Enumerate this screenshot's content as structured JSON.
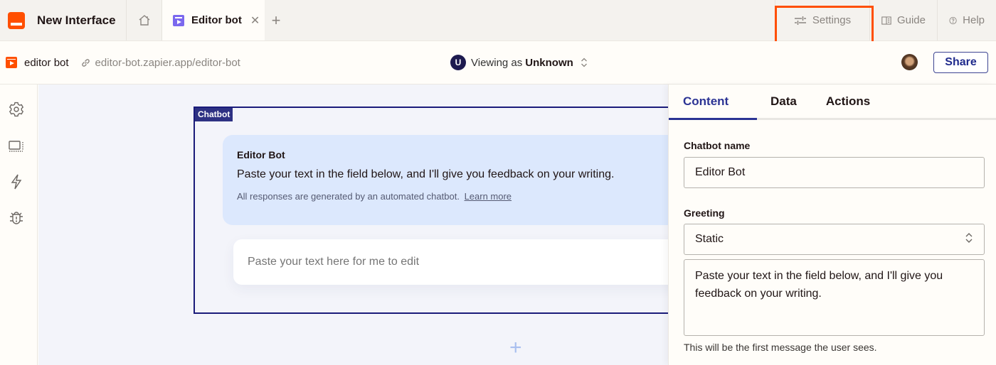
{
  "topbar": {
    "app_title": "New Interface",
    "tabs": [
      {
        "label": "Editor bot",
        "icon": "page-icon",
        "active": true
      }
    ],
    "actions": [
      {
        "label": "Settings",
        "icon": "sliders-icon",
        "highlighted": true
      },
      {
        "label": "Guide",
        "icon": "book-icon"
      },
      {
        "label": "Help",
        "icon": "question-circle-icon"
      }
    ]
  },
  "subbar": {
    "page_name": "editor bot",
    "url": "editor-bot.zapier.app/editor-bot",
    "viewing_prefix": "Viewing as",
    "viewing_user": "Unknown",
    "viewing_avatar_letter": "U",
    "share_label": "Share"
  },
  "rail": {
    "items": [
      {
        "name": "settings",
        "icon": "gear-icon"
      },
      {
        "name": "layout",
        "icon": "display-icon"
      },
      {
        "name": "automations",
        "icon": "lightning-icon"
      },
      {
        "name": "debug",
        "icon": "bug-icon"
      }
    ]
  },
  "canvas": {
    "component_label": "Chatbot",
    "bot_name": "Editor Bot",
    "greeting": "Paste your text in the field below, and I'll give you feedback on your writing.",
    "disclaimer": "All responses are generated by an automated chatbot.",
    "learn_more": "Learn more",
    "input_placeholder": "Paste your text here for me to edit"
  },
  "panel": {
    "tabs": [
      {
        "label": "Content",
        "active": true
      },
      {
        "label": "Data"
      },
      {
        "label": "Actions"
      }
    ],
    "chatbot_name_label": "Chatbot name",
    "chatbot_name_value": "Editor Bot",
    "greeting_label": "Greeting",
    "greeting_mode": "Static",
    "greeting_text": "Paste your text in the field below, and I'll give you feedback on your writing.",
    "greeting_helper": "This will be the first message the user sees."
  },
  "colors": {
    "brand": "#ff4f00",
    "accent": "#2b3394",
    "bubble": "#dce8fd",
    "canvas_bg": "#f3f4fa"
  }
}
